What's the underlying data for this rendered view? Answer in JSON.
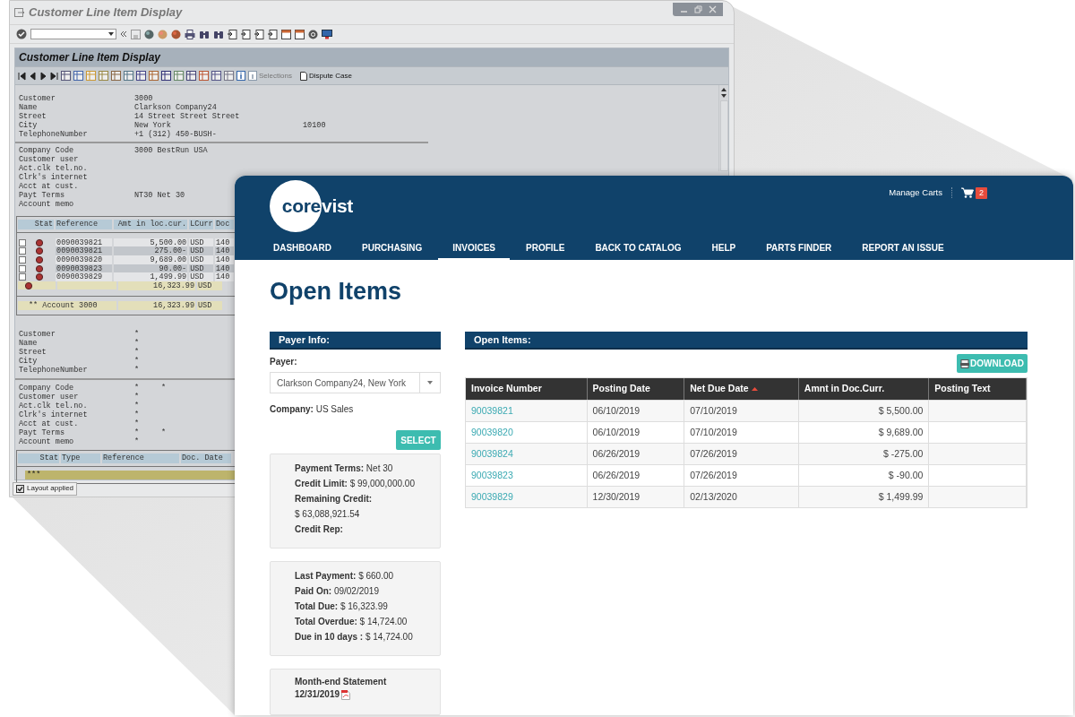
{
  "sap_window": {
    "title": "Customer Line Item Display",
    "inner_title": "Customer Line Item Display",
    "toolbar_buttons": [
      "Selections",
      "Dispute Case"
    ],
    "header_fields": [
      {
        "label": "Customer",
        "value": "3000"
      },
      {
        "label": "Name",
        "value": "Clarkson Company24"
      },
      {
        "label": "Street",
        "value": "14 Street Street Street"
      },
      {
        "label": "City",
        "value": "New York",
        "extra": "10100"
      },
      {
        "label": "TelephoneNumber",
        "value": "+1 (312) 450-BUSH-"
      }
    ],
    "company_fields": [
      {
        "label": "Company Code",
        "value": "3000 BestRun USA"
      },
      {
        "label": "Customer user"
      },
      {
        "label": "Act.clk tel.no."
      },
      {
        "label": "Clrk's internet"
      },
      {
        "label": "Acct at cust."
      },
      {
        "label": "Payt Terms",
        "value": "NT30 Net 30"
      },
      {
        "label": "Account memo"
      }
    ],
    "items_table": {
      "columns": [
        "Stat",
        "Reference",
        "Amt in loc.cur.",
        "LCurr",
        "Doc"
      ],
      "rows": [
        {
          "checked": false,
          "reference": "0090039821",
          "amount": "5,500.00",
          "currency": "USD",
          "column_5": "140"
        },
        {
          "checked": false,
          "reference": "0090039821",
          "amount": "275.00-",
          "currency": "USD",
          "column_5": "140"
        },
        {
          "checked": false,
          "reference": "0090039820",
          "amount": "9,689.00",
          "currency": "USD",
          "column_5": "140"
        },
        {
          "checked": false,
          "reference": "0090039823",
          "amount": "90.00-",
          "currency": "USD",
          "column_5": "140"
        },
        {
          "checked": false,
          "reference": "0090039829",
          "amount": "1,499.99",
          "currency": "USD",
          "column_5": "140"
        }
      ],
      "subtotal": {
        "amount": "16,323.99",
        "currency": "USD"
      },
      "total": {
        "label": "** Account 3000",
        "amount": "16,323.99",
        "currency": "USD"
      }
    },
    "header_fields_2": [
      {
        "label": "Customer",
        "value": "*"
      },
      {
        "label": "Name",
        "value": "*"
      },
      {
        "label": "Street",
        "value": "*"
      },
      {
        "label": "City",
        "value": "*"
      },
      {
        "label": "TelephoneNumber",
        "value": "*"
      }
    ],
    "company_fields_2": [
      {
        "label": "Company Code",
        "value": "*",
        "extra": "*"
      },
      {
        "label": "Customer user",
        "value": "*"
      },
      {
        "label": "Act.clk tel.no.",
        "value": "*"
      },
      {
        "label": "Clrk's internet",
        "value": "*"
      },
      {
        "label": "Acct at cust.",
        "value": "*"
      },
      {
        "label": "Payt Terms",
        "value": "*",
        "extra": "*"
      },
      {
        "label": "Account memo",
        "value": "*"
      }
    ],
    "lines_table": {
      "columns": [
        "Stat",
        "Type",
        "Reference",
        "Doc. Date"
      ],
      "rows": [
        "***"
      ]
    },
    "status": {
      "text": "Layout applied",
      "checked": true
    }
  },
  "portal": {
    "logo": [
      "core",
      "vist"
    ],
    "manage_carts": "Manage Carts",
    "cart_count": "2",
    "nav": [
      {
        "label": "DASHBOARD",
        "selected": false
      },
      {
        "label": "PURCHASING",
        "selected": false
      },
      {
        "label": "INVOICES",
        "selected": true
      },
      {
        "label": "PROFILE",
        "selected": false
      },
      {
        "label": "BACK TO CATALOG",
        "selected": false
      },
      {
        "label": "HELP",
        "selected": false
      },
      {
        "label": "PARTS FINDER",
        "selected": false
      },
      {
        "label": "REPORT AN ISSUE",
        "selected": false
      }
    ],
    "page_title": "Open Items",
    "payer_info": {
      "title": "Payer Info:",
      "payer_label": "Payer:",
      "payer_value": "Clarkson Company24, New York",
      "company": "**Company:** US Sales",
      "select_button": "SELECT",
      "cards": [
        {
          "kind": "facts",
          "lines": [
            "**Payment Terms:** Net 30",
            "**Credit Limit:** $ 99,000,000.00",
            "**Remaining Credit:**",
            "$ 63,088,921.54",
            "**Credit Rep:**"
          ]
        },
        {
          "kind": "facts",
          "lines": [
            "**Last Payment:** $ 660.00",
            "**Paid On:** 09/02/2019",
            "**Total Due:** $ 16,323.99",
            "**Total Overdue:** $ 14,724.00",
            "**Due in 10 days :** $ 14,724.00"
          ]
        },
        {
          "kind": "statement",
          "title": "Month-end Statement",
          "date": "12/31/2019"
        }
      ]
    },
    "open_items": {
      "title": "Open Items:",
      "download_button": "DOWNLOAD",
      "columns": [
        {
          "label": "Invoice Number",
          "sorted": false
        },
        {
          "label": "Posting Date",
          "sorted": false
        },
        {
          "label": "Net Due Date",
          "sorted": true
        },
        {
          "label": "Amnt in Doc.Curr.",
          "sorted": false
        },
        {
          "label": "Posting Text",
          "sorted": false
        }
      ],
      "rows": [
        [
          "90039821",
          "06/10/2019",
          "07/10/2019",
          "$ 5,500.00"
        ],
        [
          "90039820",
          "06/10/2019",
          "07/10/2019",
          "$ 9,689.00"
        ],
        [
          "90039824",
          "06/26/2019",
          "07/26/2019",
          "$ -275.00"
        ],
        [
          "90039823",
          "06/26/2019",
          "07/26/2019",
          "$ -90.00"
        ],
        [
          "90039829",
          "12/30/2019",
          "02/13/2020",
          "$ 1,499.99"
        ]
      ]
    }
  }
}
